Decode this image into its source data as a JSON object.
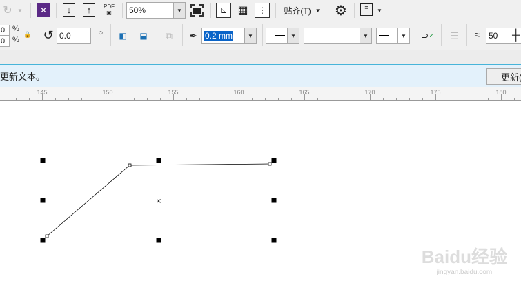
{
  "toolbar1": {
    "zoom_value": "50%",
    "pdf_label": "PDF",
    "snap_label": "贴齐(T)"
  },
  "toolbar2": {
    "scale_x_unit": "%",
    "scale_y_unit": "%",
    "scale_x": "0",
    "scale_y": "0",
    "rotation": "0.0",
    "outline_width": "0.2 mm",
    "smoothing": "50"
  },
  "notice": {
    "text": "更新文本。",
    "button": "更新("
  },
  "ruler": {
    "labels": [
      "145",
      "150",
      "155",
      "160",
      "165",
      "170",
      "175",
      "180"
    ]
  },
  "watermark": {
    "text": "Baidu经验",
    "sub": "jingyan.baidu.com"
  }
}
